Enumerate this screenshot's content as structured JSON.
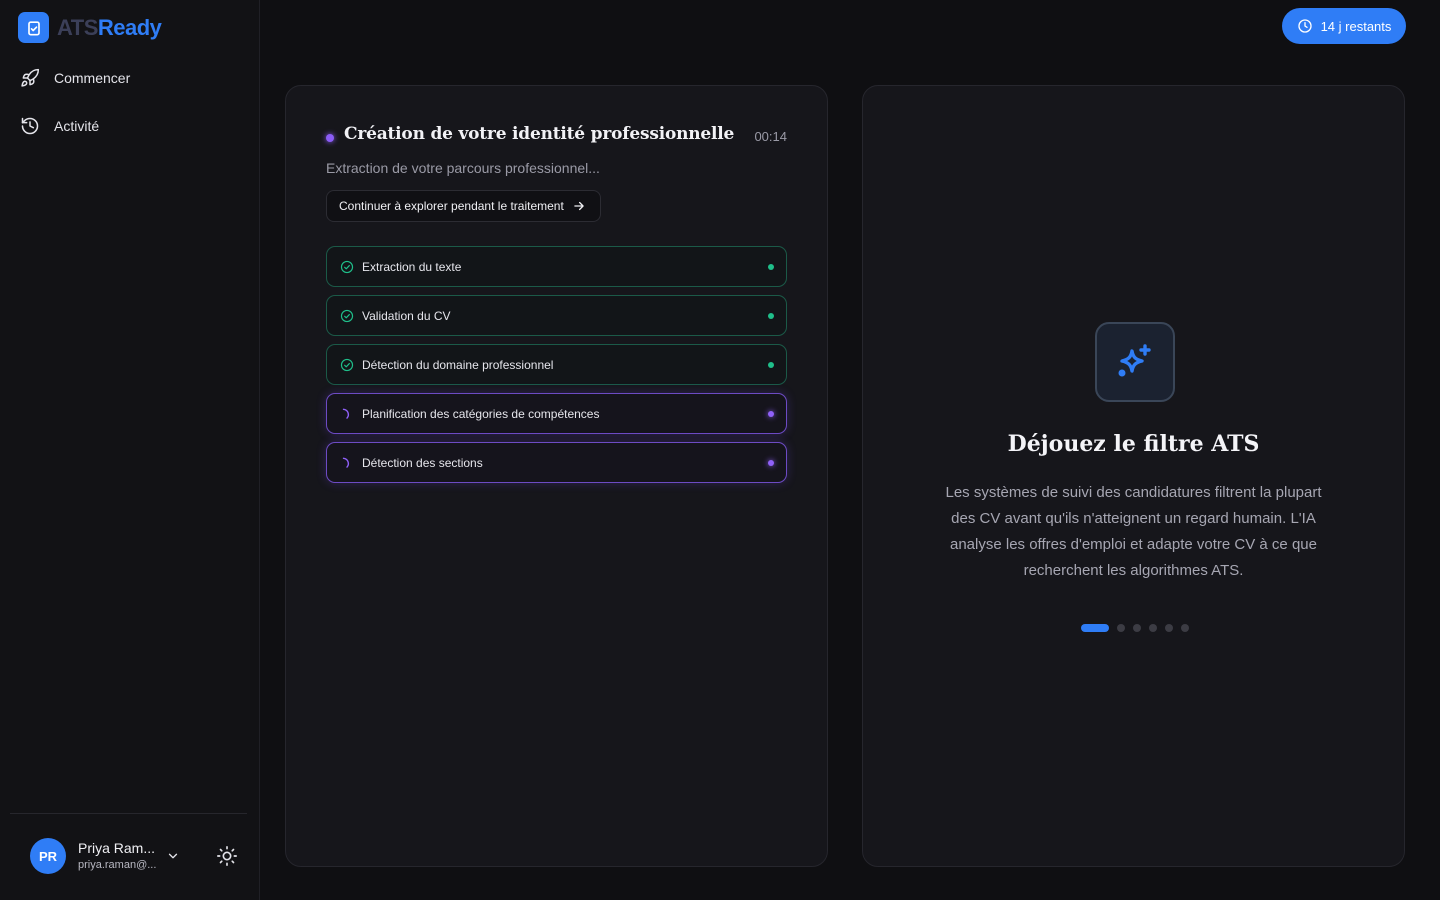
{
  "brand": {
    "ats": "ATS",
    "ready": "Ready"
  },
  "sidebar": {
    "items": [
      {
        "label": "Commencer",
        "icon": "rocket-icon"
      },
      {
        "label": "Activité",
        "icon": "history-icon"
      }
    ]
  },
  "user": {
    "initials": "PR",
    "name": "Priya Ram...",
    "email": "priya.raman@..."
  },
  "header": {
    "trial_label": "14 j restants"
  },
  "processing": {
    "title": "Création de votre identité professionnelle",
    "timer": "00:14",
    "subtitle": "Extraction de votre parcours professionnel...",
    "explore_label": "Continuer à explorer pendant le traitement",
    "steps": [
      {
        "label": "Extraction du texte",
        "status": "done"
      },
      {
        "label": "Validation du CV",
        "status": "done"
      },
      {
        "label": "Détection du domaine professionnel",
        "status": "done"
      },
      {
        "label": "Planification des catégories de compétences",
        "status": "active"
      },
      {
        "label": "Détection des sections",
        "status": "active"
      }
    ]
  },
  "feature": {
    "icon": "sparkles-icon",
    "title": "Déjouez le filtre ATS",
    "description": "Les systèmes de suivi des candidatures filtrent la plupart des CV avant qu'ils n'atteignent un regard humain. L'IA analyse les offres d'emploi et adapte votre CV à ce que recherchent les algorithmes ATS.",
    "slide_count": 6,
    "active_slide": 1
  },
  "colors": {
    "accent": "#2f7df6",
    "success": "#1fbf8a",
    "progress": "#9061f9",
    "background": "#0f0f12",
    "card": "#16161b"
  }
}
